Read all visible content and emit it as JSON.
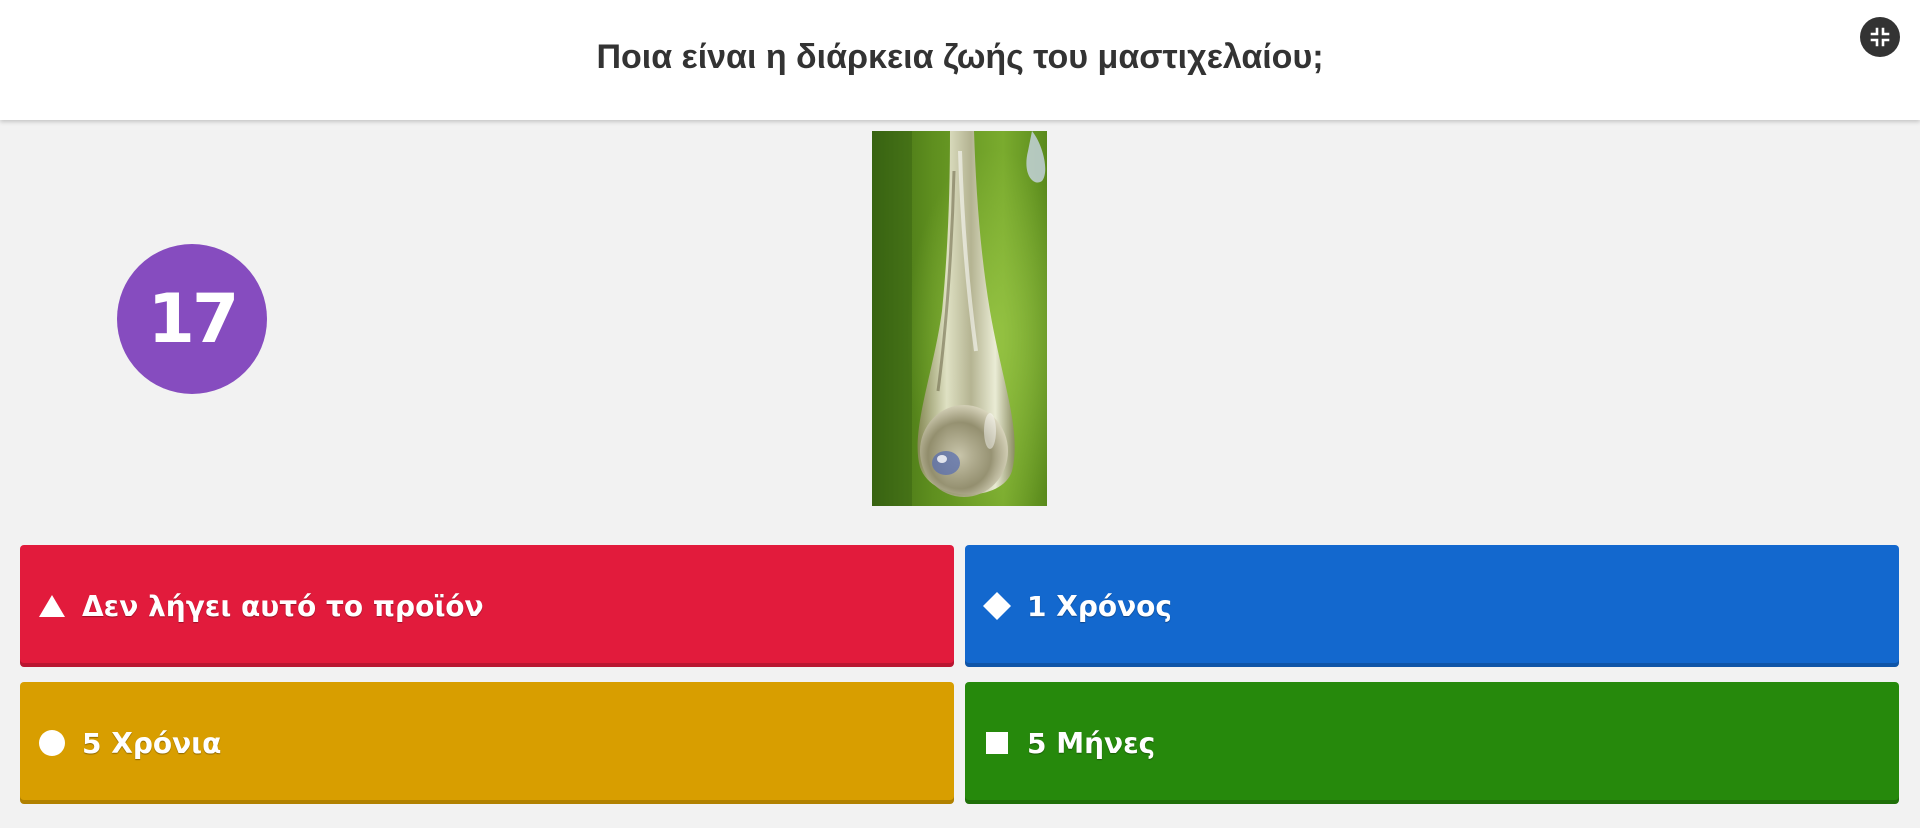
{
  "header": {
    "question": "Ποια είναι η διάρκεια ζωής του μαστιχελαίου;",
    "fullscreen_icon": "fullscreen-exit-icon"
  },
  "timer": {
    "value": "17",
    "color": "#864cbf"
  },
  "media": {
    "icon": "water-drop-photo"
  },
  "answers": [
    {
      "label": "Δεν λήγει αυτό το προϊόν",
      "shape": "triangle-icon",
      "color": "#e21b3c"
    },
    {
      "label": "1 Χρόνος",
      "shape": "diamond-icon",
      "color": "#1368ce"
    },
    {
      "label": "5 Χρόνια",
      "shape": "circle-icon",
      "color": "#d89e00"
    },
    {
      "label": "5 Μήνες",
      "shape": "square-icon",
      "color": "#26890c"
    }
  ]
}
